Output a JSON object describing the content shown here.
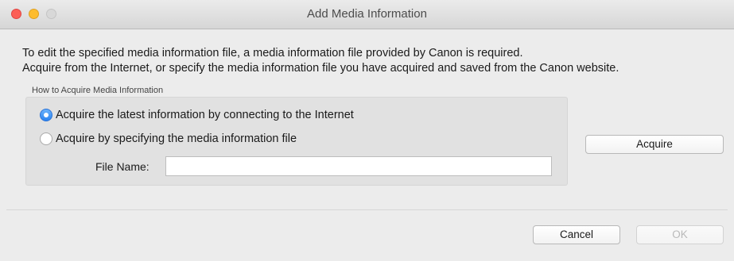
{
  "window": {
    "title": "Add Media Information"
  },
  "description": {
    "line1": "To edit the specified media information file, a media information file provided by Canon is required.",
    "line2": "Acquire from the Internet, or specify the media information file you have acquired and saved from the Canon website."
  },
  "acquire_group": {
    "label": "How to Acquire Media Information",
    "options": [
      {
        "label": "Acquire the latest information by connecting to the Internet",
        "selected": true
      },
      {
        "label": "Acquire by specifying the media information file",
        "selected": false
      }
    ],
    "file_name_label": "File Name:",
    "file_name_value": ""
  },
  "buttons": {
    "acquire": "Acquire",
    "cancel": "Cancel",
    "ok": "OK"
  },
  "colors": {
    "radio_selected": "#2a83f0",
    "close_button": "#fc5f57",
    "minimize_button": "#fdbc2e"
  }
}
